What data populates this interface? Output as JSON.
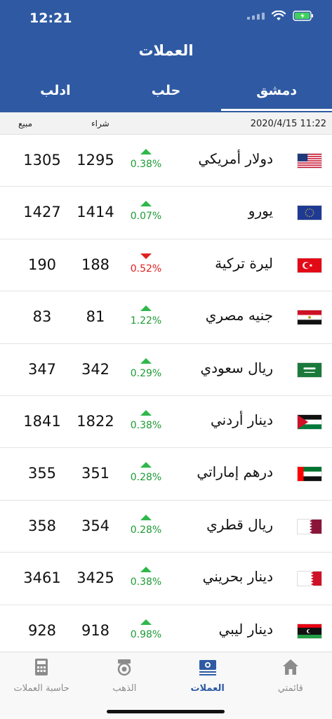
{
  "status": {
    "time": "12:21"
  },
  "title": "العملات",
  "tabs": [
    {
      "label": "ادلب",
      "active": false
    },
    {
      "label": "حلب",
      "active": false
    },
    {
      "label": "دمشق",
      "active": true
    }
  ],
  "columns": {
    "sell": "مبيع",
    "buy": "شراء"
  },
  "updated": "2020/4/15 11:22",
  "rows": [
    {
      "name": "دولار أمريكي",
      "flag": "usa-flag-icon",
      "buy": "1295",
      "sell": "1305",
      "change": "0.38%",
      "direction": "up"
    },
    {
      "name": "يورو",
      "flag": "eu-flag-icon",
      "buy": "1414",
      "sell": "1427",
      "change": "0.07%",
      "direction": "up"
    },
    {
      "name": "ليرة تركية",
      "flag": "turkey-flag-icon",
      "buy": "188",
      "sell": "190",
      "change": "0.52%",
      "direction": "down"
    },
    {
      "name": "جنيه مصري",
      "flag": "egypt-flag-icon",
      "buy": "81",
      "sell": "83",
      "change": "1.22%",
      "direction": "up"
    },
    {
      "name": "ريال سعودي",
      "flag": "saudi-flag-icon",
      "buy": "342",
      "sell": "347",
      "change": "0.29%",
      "direction": "up"
    },
    {
      "name": "دينار أردني",
      "flag": "jordan-flag-icon",
      "buy": "1822",
      "sell": "1841",
      "change": "0.38%",
      "direction": "up"
    },
    {
      "name": "درهم إماراتي",
      "flag": "uae-flag-icon",
      "buy": "351",
      "sell": "355",
      "change": "0.28%",
      "direction": "up"
    },
    {
      "name": "ريال قطري",
      "flag": "qatar-flag-icon",
      "buy": "354",
      "sell": "358",
      "change": "0.28%",
      "direction": "up"
    },
    {
      "name": "دينار بحريني",
      "flag": "bahrain-flag-icon",
      "buy": "3425",
      "sell": "3461",
      "change": "0.38%",
      "direction": "up"
    },
    {
      "name": "دينار ليبي",
      "flag": "libya-flag-icon",
      "buy": "918",
      "sell": "928",
      "change": "0.98%",
      "direction": "up"
    }
  ],
  "nav": [
    {
      "label": "حاسبة العملات",
      "icon": "calculator-icon",
      "active": false
    },
    {
      "label": "الذهب",
      "icon": "gold-icon",
      "active": false
    },
    {
      "label": "العملات",
      "icon": "banknote-icon",
      "active": true
    },
    {
      "label": "قائمتي",
      "icon": "home-icon",
      "active": false
    }
  ],
  "colors": {
    "header": "#2f5aa3",
    "up": "#1f9a36",
    "down": "#e02020"
  }
}
